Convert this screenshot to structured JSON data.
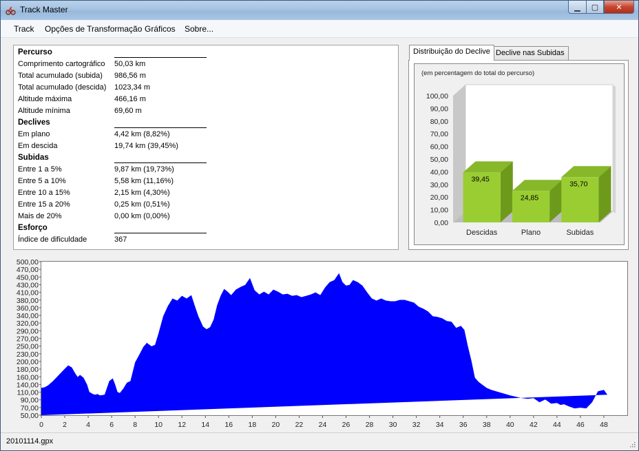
{
  "window": {
    "title": "Track Master"
  },
  "menu": {
    "items": [
      "Track",
      "Opções de Transformação",
      "Gráficos",
      "Sobre..."
    ]
  },
  "info": {
    "sections": [
      {
        "title": "Percurso",
        "rows": [
          {
            "label": "Comprimento cartográfico",
            "value": "50,03 km"
          },
          {
            "label": "Total acumulado (subida)",
            "value": "986,56 m"
          },
          {
            "label": "Total acumulado (descida)",
            "value": "1023,34 m"
          },
          {
            "label": "Altitude máxima",
            "value": "466,16 m"
          },
          {
            "label": "Altitude mínima",
            "value": "69,60 m"
          }
        ]
      },
      {
        "title": "Declives",
        "rows": [
          {
            "label": "Em plano",
            "value": "4,42 km (8,82%)"
          },
          {
            "label": "Em descida",
            "value": "19,74 km (39,45%)"
          }
        ]
      },
      {
        "title": "Subidas",
        "rows": [
          {
            "label": "Entre 1 a 5%",
            "value": "9,87 km (19,73%)"
          },
          {
            "label": "Entre 5 a 10%",
            "value": "5,58 km (11,16%)"
          },
          {
            "label": "Entre 10 a 15%",
            "value": "2,15 km (4,30%)"
          },
          {
            "label": "Entre 15 a 20%",
            "value": "0,25 km (0,51%)"
          },
          {
            "label": "Mais de 20%",
            "value": "0,00 km (0,00%)"
          }
        ]
      },
      {
        "title": "Esforço",
        "rows": [
          {
            "label": "Índice de dificuldade",
            "value": "367"
          }
        ]
      }
    ]
  },
  "tabs": [
    {
      "label": "Distribuição do Declive",
      "active": true
    },
    {
      "label": "Declive nas Subidas",
      "active": false
    }
  ],
  "chart_data": [
    {
      "type": "bar",
      "subtitle": "(em percentagem do total do percurso)",
      "categories": [
        "Descidas",
        "Plano",
        "Subidas"
      ],
      "values": [
        39.45,
        24.85,
        35.7
      ],
      "value_labels": [
        "39,45",
        "24,85",
        "35,70"
      ],
      "ylim": [
        0,
        100
      ],
      "yticks": [
        "0,00",
        "10,00",
        "20,00",
        "30,00",
        "40,00",
        "50,00",
        "60,00",
        "70,00",
        "80,00",
        "90,00",
        "100,00"
      ],
      "bar_color": "#9acd32",
      "style": "3d"
    },
    {
      "type": "area",
      "xlabel": "",
      "ylabel": "",
      "xlim": [
        0,
        50
      ],
      "ylim": [
        50,
        500
      ],
      "xticks": [
        "0",
        "2",
        "4",
        "6",
        "8",
        "10",
        "12",
        "14",
        "16",
        "18",
        "20",
        "22",
        "24",
        "26",
        "28",
        "30",
        "32",
        "34",
        "36",
        "38",
        "40",
        "42",
        "44",
        "46",
        "48"
      ],
      "yticks": [
        "50,00",
        "70,00",
        "90,00",
        "110,00",
        "140,00",
        "160,00",
        "180,00",
        "200,00",
        "230,00",
        "250,00",
        "270,00",
        "290,00",
        "320,00",
        "340,00",
        "360,00",
        "380,00",
        "410,00",
        "430,00",
        "450,00",
        "470,00",
        "500,00"
      ],
      "fill_color": "#0000ff",
      "x": [
        0,
        0.3,
        0.6,
        1,
        1.5,
        2,
        2.3,
        2.6,
        2.9,
        3.1,
        3.3,
        3.6,
        3.9,
        4.1,
        4.4,
        4.6,
        4.8,
        5.0,
        5.4,
        5.8,
        6.1,
        6.3,
        6.5,
        6.7,
        7.0,
        7.3,
        7.6,
        8,
        8.4,
        8.7,
        9,
        9.4,
        9.7,
        10.0,
        10.4,
        10.8,
        11.2,
        11.6,
        12,
        12.4,
        12.8,
        13.1,
        13.4,
        13.8,
        14.1,
        14.4,
        14.7,
        15.0,
        15.3,
        15.6,
        15.9,
        16.2,
        16.6,
        17,
        17.4,
        17.8,
        18.2,
        18.6,
        19,
        19.4,
        19.8,
        20.2,
        20.6,
        21,
        21.4,
        21.8,
        22.2,
        22.6,
        23,
        23.4,
        23.8,
        24.2,
        24.6,
        25,
        25.4,
        25.7,
        26,
        26.3,
        26.6,
        27,
        27.4,
        27.8,
        28.2,
        28.6,
        29,
        29.4,
        29.8,
        30.2,
        30.6,
        31,
        31.4,
        31.8,
        32.2,
        32.6,
        33,
        33.4,
        33.8,
        34.2,
        34.6,
        35,
        35.4,
        35.8,
        36.1,
        36.4,
        36.7,
        37,
        37.3,
        37.6,
        38,
        38.4,
        38.8,
        39.2,
        39.6,
        40,
        40.5,
        41,
        41.5,
        42,
        42.5,
        43,
        43.5,
        44,
        44.3,
        44.6,
        45,
        45.5,
        46,
        46.5,
        47,
        47.5,
        48,
        48.3,
        48.6,
        49,
        49.3,
        49.7,
        50
      ],
      "y": [
        130,
        132,
        138,
        150,
        168,
        186,
        196,
        190,
        172,
        162,
        168,
        160,
        140,
        118,
        112,
        110,
        112,
        108,
        110,
        150,
        158,
        140,
        118,
        115,
        128,
        145,
        150,
        205,
        230,
        250,
        262,
        252,
        256,
        290,
        340,
        370,
        392,
        386,
        400,
        392,
        402,
        370,
        340,
        310,
        302,
        308,
        330,
        372,
        400,
        420,
        412,
        402,
        418,
        426,
        432,
        452,
        416,
        404,
        412,
        404,
        418,
        412,
        404,
        406,
        400,
        402,
        396,
        400,
        404,
        410,
        402,
        424,
        440,
        446,
        466,
        440,
        430,
        432,
        446,
        440,
        430,
        410,
        392,
        386,
        392,
        386,
        384,
        384,
        388,
        388,
        384,
        380,
        368,
        362,
        354,
        340,
        338,
        334,
        326,
        324,
        306,
        312,
        300,
        252,
        210,
        160,
        148,
        140,
        130,
        124,
        120,
        116,
        112,
        108,
        104,
        100,
        98,
        100,
        88,
        96,
        84,
        86,
        80,
        82,
        76,
        70,
        72,
        70,
        88,
        120,
        124,
        110
      ]
    }
  ],
  "status": {
    "file": "20101114.gpx"
  }
}
